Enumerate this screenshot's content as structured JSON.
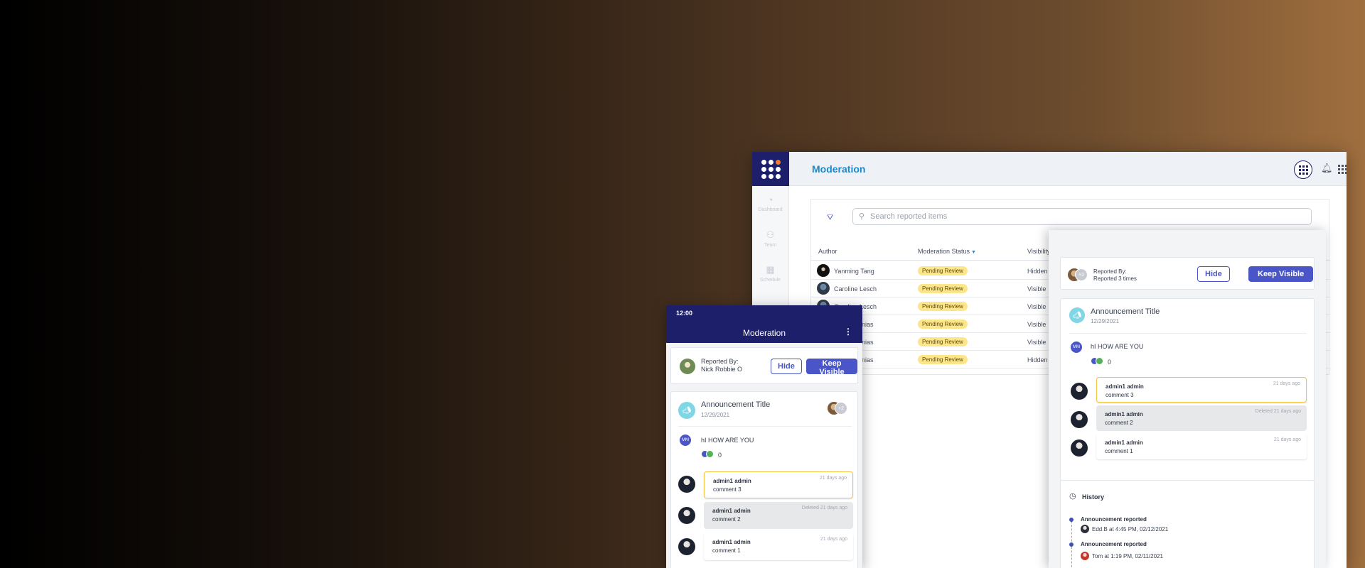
{
  "desktop": {
    "page_title": "Moderation",
    "rail": [
      {
        "label": "Dashboard",
        "icon": "dashboard-icon"
      },
      {
        "label": "Team",
        "icon": "team-icon"
      },
      {
        "label": "Schedule",
        "icon": "calendar-icon"
      }
    ],
    "search": {
      "placeholder": "Search reported items"
    },
    "table": {
      "headers": [
        "Author",
        "Moderation Status",
        "Visibility"
      ],
      "rows": [
        {
          "author": "Yanming Tang",
          "status": "Pending Review",
          "visibility": "Hidden"
        },
        {
          "author": "Caroline Lesch",
          "status": "Pending Review",
          "visibility": "Visible"
        },
        {
          "author": "Caroline Lesch",
          "status": "Pending Review",
          "visibility": "Visible"
        },
        {
          "author": "onias",
          "status": "Pending Review",
          "visibility": "Visible"
        },
        {
          "author": "onias",
          "status": "Pending Review",
          "visibility": "Visible"
        },
        {
          "author": "onias",
          "status": "Pending Review",
          "visibility": "Hidden"
        }
      ]
    }
  },
  "detail": {
    "reported_by_label": "Reported By:",
    "reported_by_value": "Reported 3 times",
    "extra_reporters": "+2",
    "hide_label": "Hide",
    "keep_visible_label": "Keep Visible",
    "announcement": {
      "title": "Announcement Title",
      "date": "12/29/2021"
    },
    "post": {
      "initials": "MM",
      "body": "hI HOW ARE YOU",
      "reaction_count": "0"
    },
    "comments": [
      {
        "author": "admin1 admin",
        "text": "comment 3",
        "time": "21 days ago",
        "state": "highlighted"
      },
      {
        "author": "admin1 admin",
        "text": "comment 2",
        "time": "Deleted 21 days ago",
        "state": "deleted"
      },
      {
        "author": "admin1 admin",
        "text": "comment 1",
        "time": "21 days ago",
        "state": "normal"
      }
    ],
    "history": {
      "title": "History",
      "events": [
        {
          "event": "Announcement reported",
          "by": "Edd.B at 4:45 PM, 02/12/2021"
        },
        {
          "event": "Announcement reported",
          "by": "Tom at 1:19 PM, 02/11/2021"
        }
      ]
    }
  },
  "mobile": {
    "time": "12:00",
    "title": "Moderation",
    "reported_by_label": "Reported By:",
    "reported_by_value": "Nick Robbie O",
    "hide_label": "Hide",
    "keep_visible_label": "Keep Visible",
    "announcement": {
      "title": "Announcement Title",
      "date": "12/29/2021",
      "extra_reporters": "+2"
    },
    "post": {
      "initials": "MM",
      "body": "hI HOW ARE YOU",
      "reaction_count": "0"
    },
    "comments": [
      {
        "author": "admin1 admin",
        "text": "comment 3",
        "time": "21 days ago"
      },
      {
        "author": "admin1 admin",
        "text": "comment 2",
        "time": "Deleted 21 days ago"
      },
      {
        "author": "admin1 admin",
        "text": "comment 1",
        "time": "21 days ago"
      }
    ]
  },
  "colors": {
    "brand_navy": "#1d1f6b",
    "accent_blue": "#4a56c8",
    "title_blue": "#1e88c8",
    "pending_yellow": "#fde68a",
    "highlight_border": "#f2c443"
  }
}
